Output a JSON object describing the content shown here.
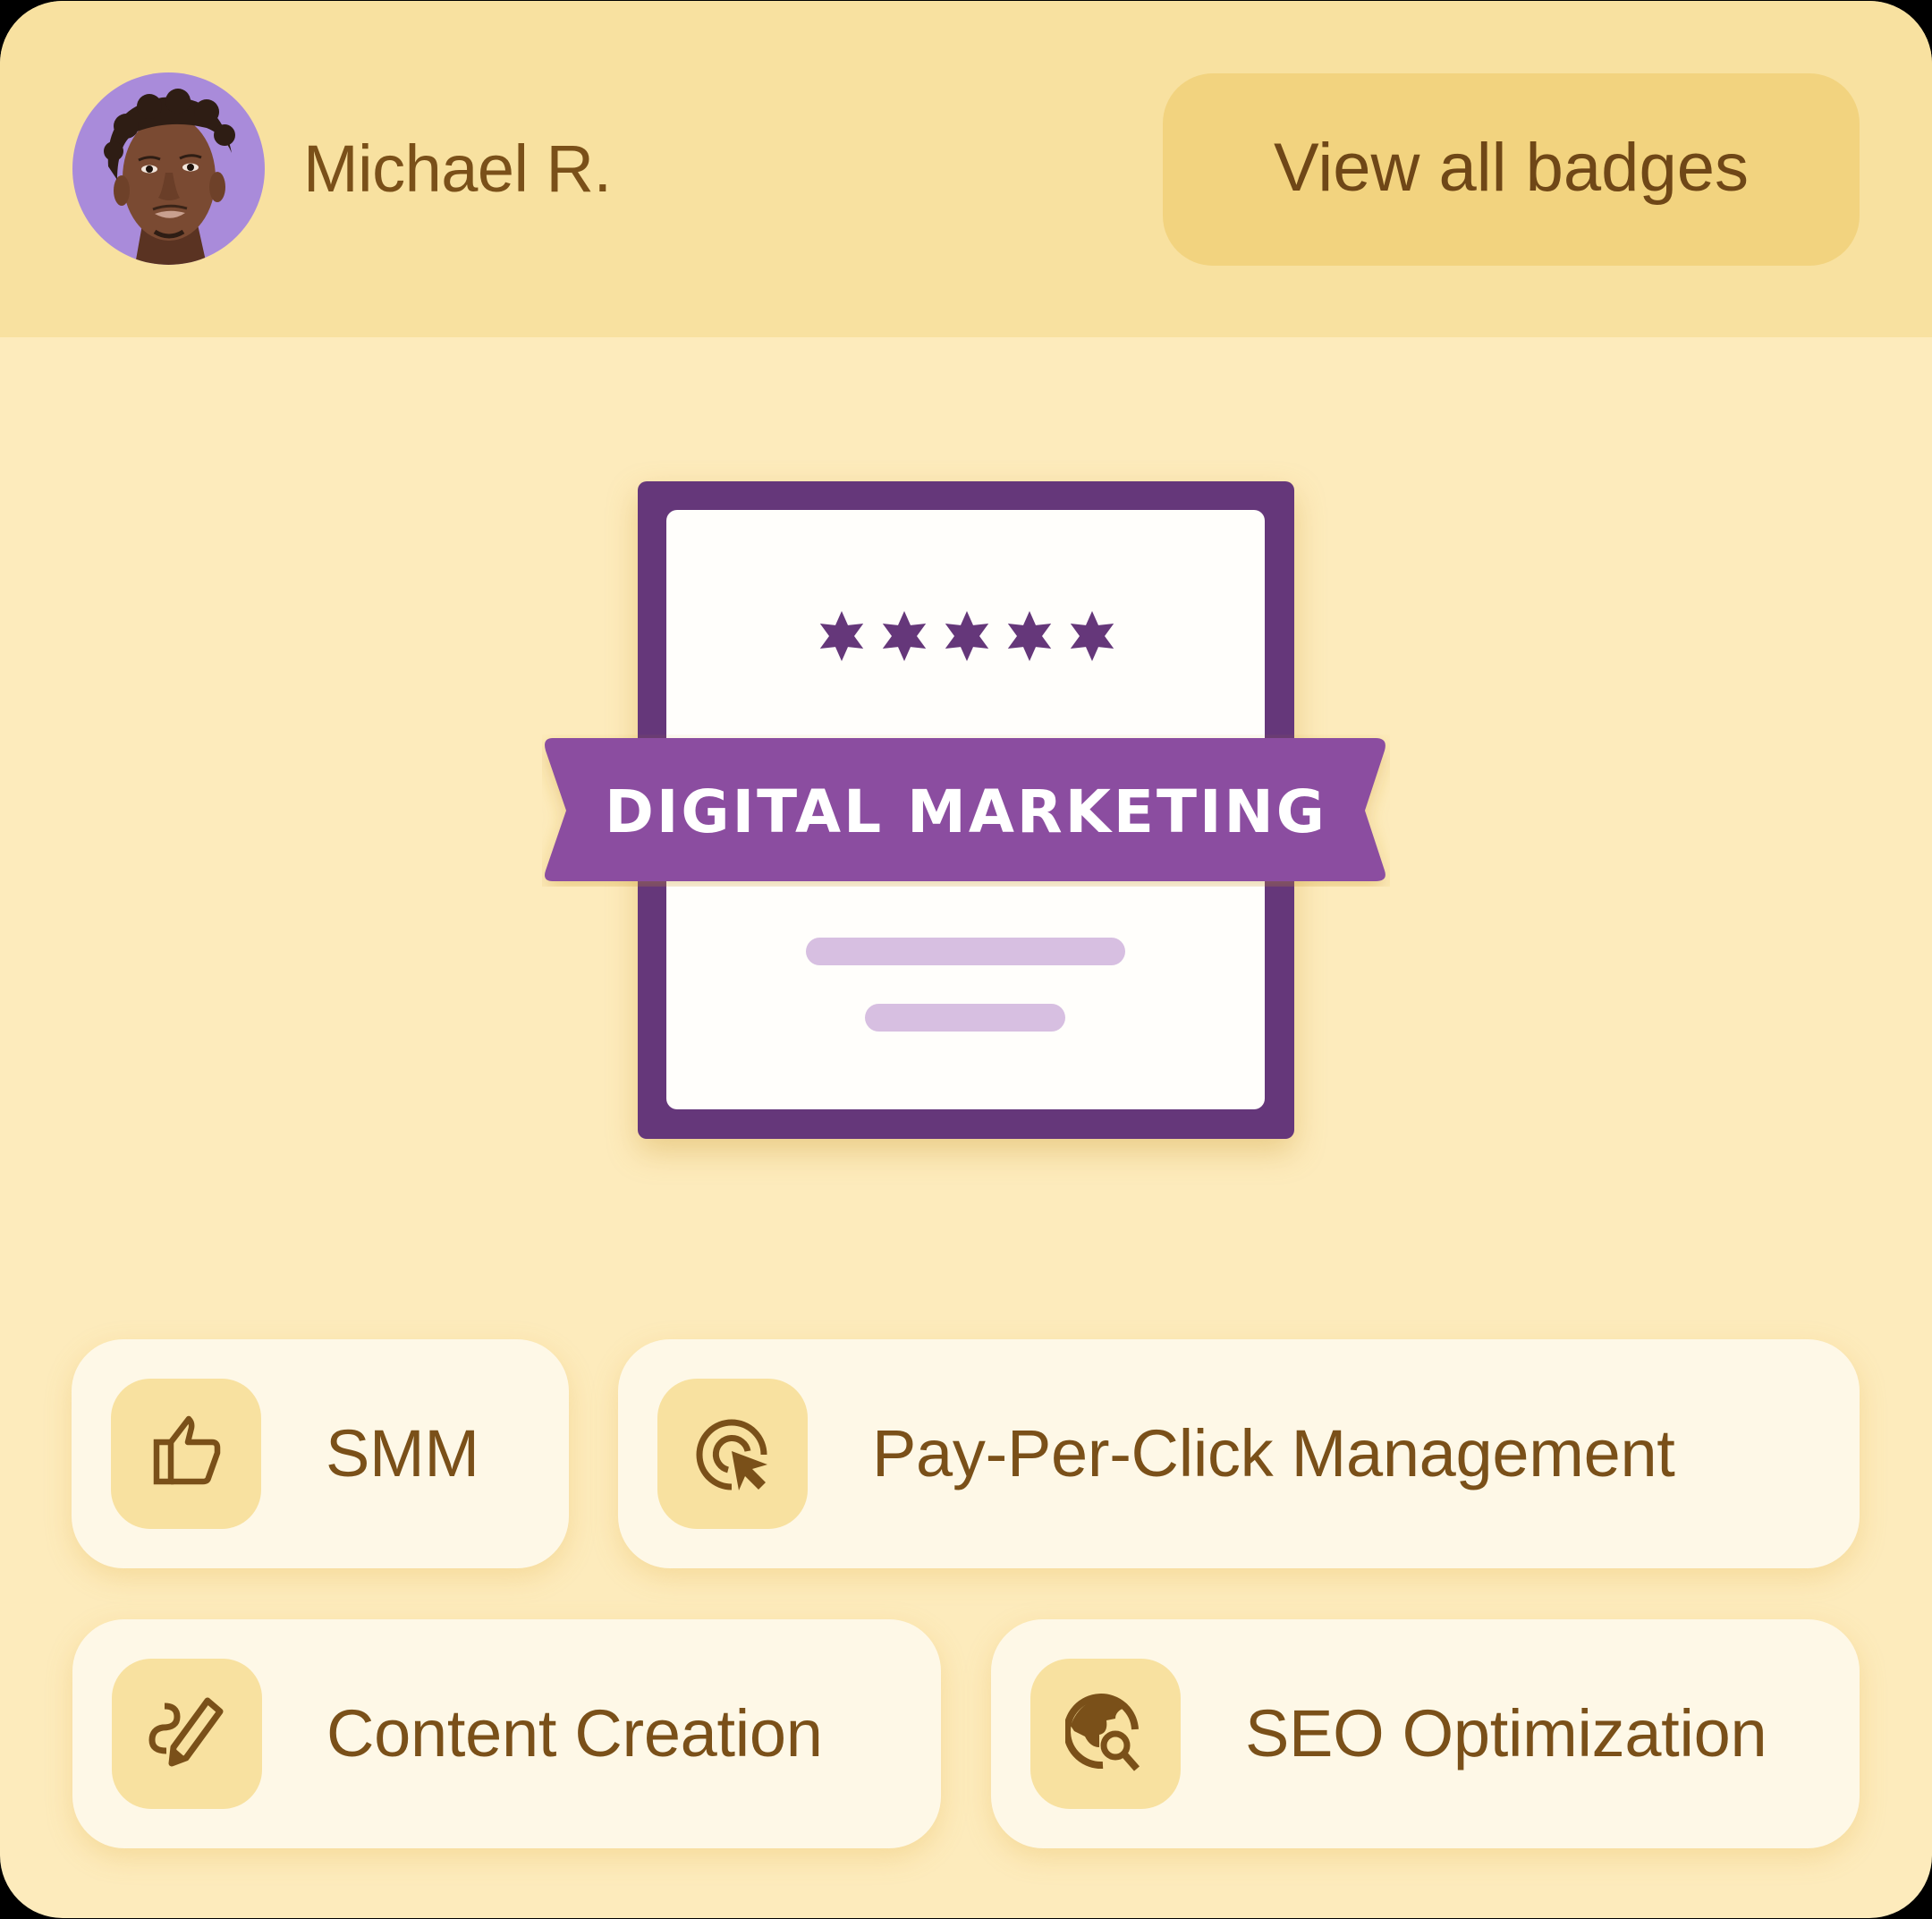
{
  "header": {
    "user_name": "Michael R.",
    "view_all_badges_label": "View all badges",
    "avatar": "user-avatar-photo"
  },
  "badge": {
    "title": "DIGITAL MARKETING",
    "rating": 5,
    "rating_max": 5,
    "star_icon": "six-point-star"
  },
  "skills": [
    {
      "label": "SMM",
      "icon": "thumbs-up-icon"
    },
    {
      "label": "Pay-Per-Click Management",
      "icon": "target-cursor-icon"
    },
    {
      "label": "Content Creation",
      "icon": "pen-squiggle-icon"
    },
    {
      "label": "SEO Optimization",
      "icon": "globe-search-icon"
    }
  ],
  "colors": {
    "header_bg": "#F8E1A0",
    "body_bg": "#FDEBBC",
    "button_bg": "#F2D37F",
    "text_brown": "#7A5019",
    "badge_frame": "#65377A",
    "ribbon": "#8B4EA0",
    "placeholder_bar": "#D7BFE1",
    "chip_bg": "#FEF8E7",
    "avatar_bg": "#A98BDA"
  }
}
